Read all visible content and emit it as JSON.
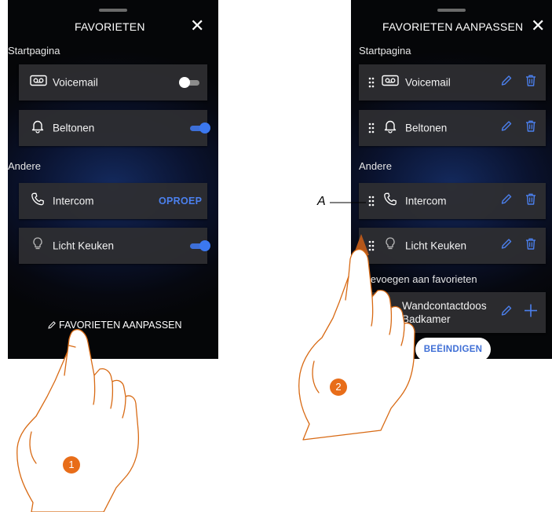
{
  "left_screen": {
    "title": "FAVORIETEN",
    "close_symbol": "✕",
    "section_start": "Startpagina",
    "section_other": "Andere",
    "rows": [
      {
        "label": "Voicemail",
        "icon": "voicemail-icon",
        "control": "toggle",
        "state": "off"
      },
      {
        "label": "Beltonen",
        "icon": "bell-icon",
        "control": "toggle",
        "state": "on"
      },
      {
        "label": "Intercom",
        "icon": "phone-icon",
        "control": "action",
        "action_label": "OPROEP"
      },
      {
        "label": "Licht Keuken",
        "icon": "bulb-icon",
        "control": "toggle",
        "state": "on"
      }
    ],
    "edit_link": "FAVORIETEN AANPASSEN"
  },
  "right_screen": {
    "title": "FAVORIETEN AANPASSEN",
    "close_symbol": "✕",
    "section_start": "Startpagina",
    "section_other": "Andere",
    "section_add": "Toevoegen aan favorieten",
    "rows": [
      {
        "label": "Voicemail",
        "icon": "voicemail-icon"
      },
      {
        "label": "Beltonen",
        "icon": "bell-icon"
      },
      {
        "label": "Intercom",
        "icon": "phone-icon"
      },
      {
        "label": "Licht Keuken",
        "icon": "bulb-icon"
      }
    ],
    "add_row": {
      "label_line1": "Wandcontactdoos",
      "label_line2": "Badkamer",
      "icon": "plug-icon"
    },
    "done_button": "BEËINDIGEN"
  },
  "annotations": {
    "step1": "1",
    "step2": "2",
    "callout": "A"
  },
  "colors": {
    "accent_blue": "#3b78f0",
    "step_badge": "#e86d19",
    "drag_arrow": "#b5571a"
  }
}
